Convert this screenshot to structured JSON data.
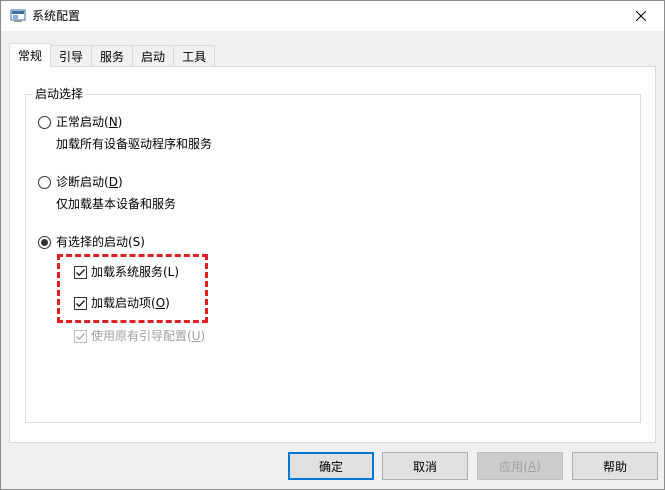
{
  "window": {
    "title": "系统配置",
    "close_label": "×"
  },
  "tabs": [
    {
      "label": "常规",
      "active": true
    },
    {
      "label": "引导",
      "active": false
    },
    {
      "label": "服务",
      "active": false
    },
    {
      "label": "启动",
      "active": false
    },
    {
      "label": "工具",
      "active": false
    }
  ],
  "startup_group": {
    "legend": "启动选择",
    "normal": {
      "label": "正常启动(",
      "mnemonic": "N",
      "label_end": ")",
      "description": "加载所有设备驱动程序和服务",
      "checked": false
    },
    "diagnostic": {
      "label": "诊断启动(",
      "mnemonic": "D",
      "label_end": ")",
      "description": "仅加载基本设备和服务",
      "checked": false
    },
    "selective": {
      "label": "有选择的启动(S)",
      "checked": true
    },
    "load_services": {
      "label": "加载系统服务(L)",
      "checked": true
    },
    "load_startup": {
      "label": "加载启动项(",
      "mnemonic": "O",
      "label_end": ")",
      "checked": true
    },
    "use_original": {
      "label": "使用原有引导配置(",
      "mnemonic": "U",
      "label_end": ")",
      "checked": true,
      "disabled": true
    }
  },
  "buttons": {
    "ok": "确定",
    "cancel": "取消",
    "apply": "应用(",
    "apply_mnemonic": "A",
    "apply_end": ")",
    "help": "帮助"
  },
  "colors": {
    "highlight": "#e02020",
    "primary_border": "#0078d7"
  }
}
